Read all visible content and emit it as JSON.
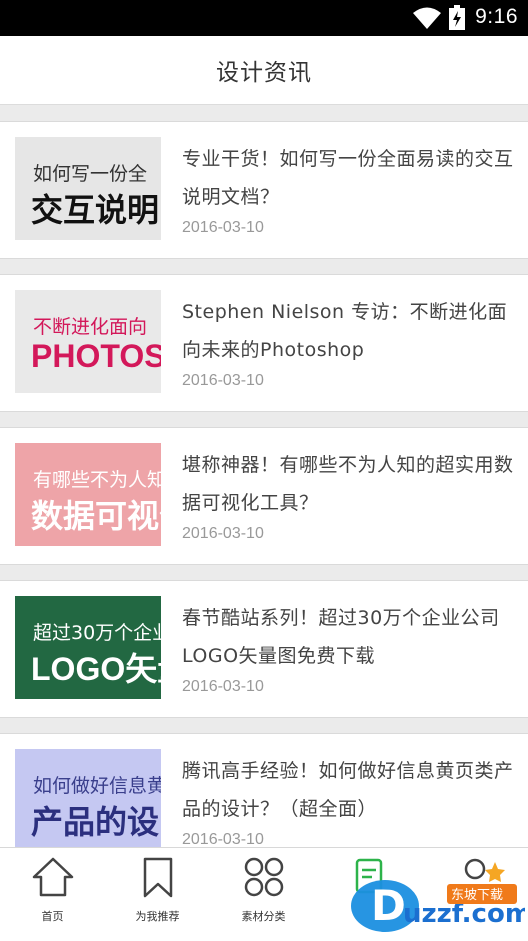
{
  "status_bar": {
    "time": "9:16"
  },
  "header": {
    "title": "设计资讯"
  },
  "articles": [
    {
      "thumb": {
        "line1": "如何写一份全",
        "line2": "交互说明",
        "bg": "#e6e6e6",
        "fg1": "#333333",
        "fg2": "#111111"
      },
      "title": "专业干货！如何写一份全面易读的交互说明文档？",
      "date": "2016-03-10"
    },
    {
      "thumb": {
        "line1": "不断进化面向",
        "line2": "PHOTOSHOP",
        "bg": "#e9e9e9",
        "fg1": "#d3185a",
        "fg2": "#d3185a"
      },
      "title": "Stephen Nielson 专访：不断进化面向未来的Photoshop",
      "date": "2016-03-10"
    },
    {
      "thumb": {
        "line1": "有哪些不为人知",
        "line2": "数据可视化",
        "bg": "#eea4a8",
        "fg1": "#ffffff",
        "fg2": "#ffffff"
      },
      "title": "堪称神器！有哪些不为人知的超实用数据可视化工具？",
      "date": "2016-03-10"
    },
    {
      "thumb": {
        "line1": "超过30万个企业",
        "line2": "LOGO矢量",
        "bg": "#226842",
        "fg1": "#ffffff",
        "fg2": "#ffffff"
      },
      "title": "春节酷站系列！超过30万个企业公司LOGO矢量图免费下载",
      "date": "2016-03-10"
    },
    {
      "thumb": {
        "line1": "如何做好信息黄",
        "line2": "产品的设",
        "bg": "#c5c8f2",
        "fg1": "#3a3f8c",
        "fg2": "#2b2f7e"
      },
      "title": "腾讯高手经验！如何做好信息黄页类产品的设计？（超全面）",
      "date": "2016-03-10"
    }
  ],
  "tabs": [
    {
      "label": "首页",
      "icon": "home-icon"
    },
    {
      "label": "为我推荐",
      "icon": "bookmark-icon"
    },
    {
      "label": "素材分类",
      "icon": "grid-icon"
    },
    {
      "label": "",
      "icon": "document-icon"
    },
    {
      "label": "",
      "icon": "user-icon"
    }
  ],
  "watermark": {
    "text": "uzzf.com",
    "tag": "东坡下载"
  }
}
